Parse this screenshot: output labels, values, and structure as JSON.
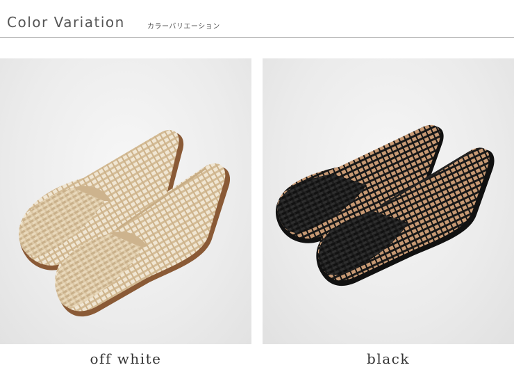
{
  "header": {
    "title": "Color Variation",
    "subtitle": "カラーバリエーション"
  },
  "variants": [
    {
      "label": "off white",
      "color": "#d9c5a3",
      "shade": "#b69c74",
      "sole": "#8a5a36"
    },
    {
      "label": "black",
      "color": "#1c1c1c",
      "shade": "#0a0a0a",
      "sole": "#2a2a2a"
    }
  ],
  "colors": {
    "rule": "#9a9a9a",
    "panel_bg": "#ececec",
    "text": "#555555"
  }
}
